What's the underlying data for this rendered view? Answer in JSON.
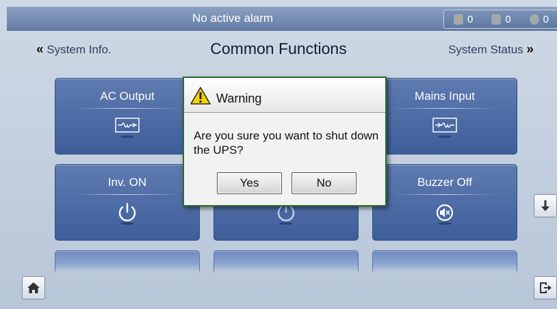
{
  "top_bar": {
    "alarm_message": "No active alarm",
    "counters": [
      {
        "icon": "critical-alarm-icon",
        "value": "0"
      },
      {
        "icon": "major-alarm-icon",
        "value": "0"
      },
      {
        "icon": "minor-alarm-icon",
        "value": "0"
      }
    ]
  },
  "nav": {
    "prev_label": "System Info.",
    "prev_chevron": "«",
    "title": "Common Functions",
    "next_label": "System Status",
    "next_chevron": "»"
  },
  "tiles": [
    {
      "label": "AC Output",
      "icon": "ac-output-waveform-icon"
    },
    {
      "label": "",
      "icon": ""
    },
    {
      "label": "Mains Input",
      "icon": "mains-input-waveform-icon"
    },
    {
      "label": "Inv. ON",
      "icon": "power-on-icon"
    },
    {
      "label": "",
      "icon": "power-off-icon"
    },
    {
      "label": "Buzzer Off",
      "icon": "speaker-mute-icon"
    }
  ],
  "dialog": {
    "title": "Warning",
    "message": "Are you sure you want to shut down the UPS?",
    "yes_label": "Yes",
    "no_label": "No",
    "icon": "warning-icon"
  },
  "side_buttons": {
    "scroll_down_icon": "arrow-down-icon",
    "home_icon": "home-icon",
    "logout_icon": "logout-icon"
  },
  "colors": {
    "tile_blue": "#4a68a5",
    "header_blue": "#7890b5",
    "dialog_border": "#2a6b2c",
    "warning_yellow": "#f5d400"
  }
}
